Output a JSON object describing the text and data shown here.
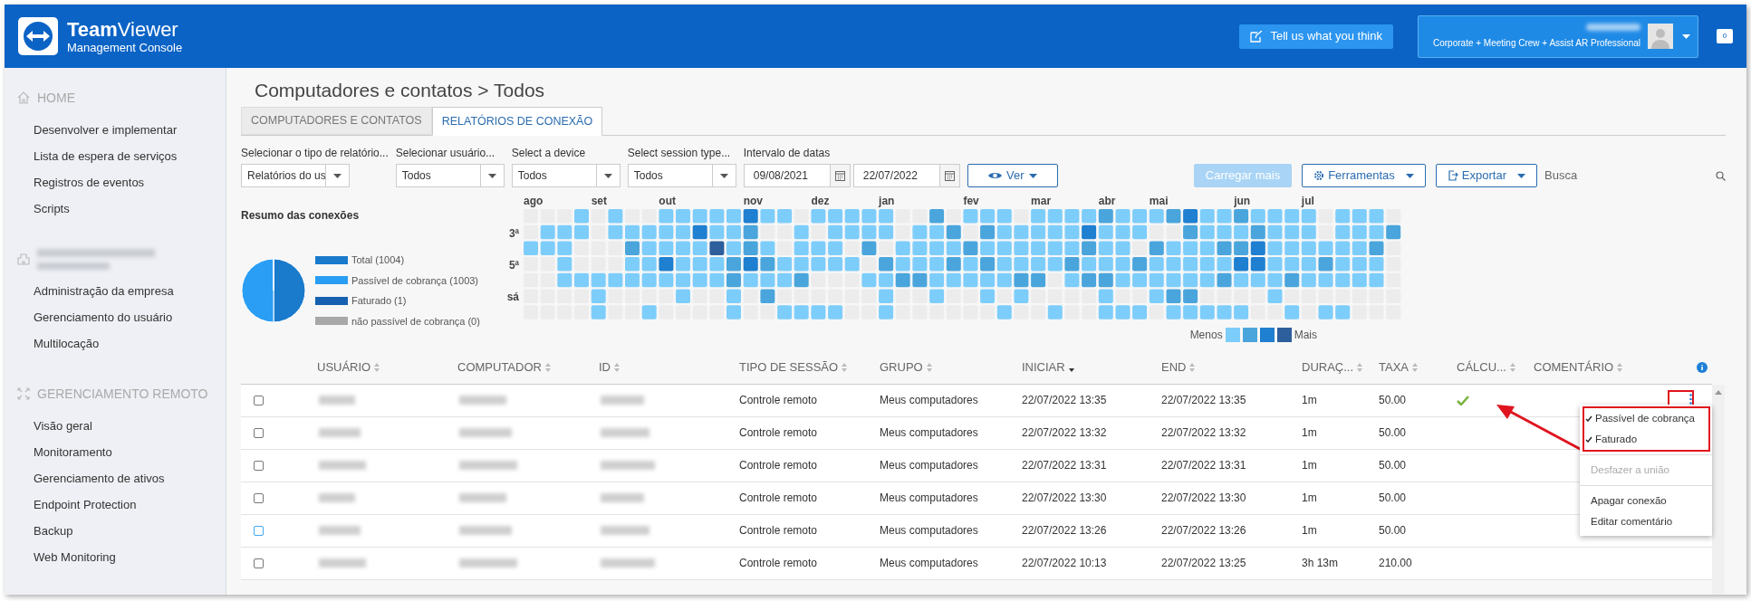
{
  "header": {
    "logo": "**Team**Viewer",
    "subtitle": "Management Console",
    "feedback_button": "Tell us what you think",
    "account": {
      "plan": "Corporate + Meeting Crew + Assist AR Professional"
    },
    "notifications": "0"
  },
  "sidebar": {
    "sections": [
      {
        "kind": "heading",
        "title": "HOME",
        "items": [
          "Desenvolver e implementar",
          "Lista de espera de serviços",
          "Registros de eventos",
          "Scripts"
        ]
      },
      {
        "kind": "redacted",
        "items": [
          "Administração da empresa",
          "Gerenciamento do usuário",
          "Multilocação"
        ]
      },
      {
        "kind": "heading",
        "title": "GERENCIAMENTO REMOTO",
        "items": [
          "Visão geral",
          "Monitoramento",
          "Gerenciamento de ativos",
          "Endpoint Protection",
          "Backup",
          "Web Monitoring"
        ]
      }
    ]
  },
  "breadcrumb": "Computadores e contatos > Todos",
  "tabs": [
    {
      "label": "COMPUTADORES E CONTATOS",
      "selected": false
    },
    {
      "label": "RELATÓRIOS DE CONEXÃO",
      "selected": true
    }
  ],
  "filters": [
    {
      "kind": "select",
      "label": "Selecionar o tipo de relatório...",
      "value": "Relatórios do us"
    },
    {
      "kind": "select",
      "label": "Selecionar usuário...",
      "value": "Todos"
    },
    {
      "kind": "select",
      "label": "Select a device",
      "value": "Todos"
    },
    {
      "kind": "select",
      "label": "Select session type...",
      "value": "Todos"
    },
    {
      "kind": "daterange",
      "label": "Intervalo de datas",
      "values": [
        "09/08/2021",
        "22/07/2022"
      ]
    }
  ],
  "view_button": "Ver",
  "toolbar": {
    "buttons": [
      {
        "label": "Carregar mais",
        "kind": "primary",
        "disabled": true
      },
      {
        "label": "Ferramentas",
        "kind": "tools",
        "disabled": false
      },
      {
        "label": "Exportar",
        "kind": "export",
        "disabled": false
      }
    ],
    "search": {
      "placeholder": "Busca"
    }
  },
  "summary": {
    "title": "Resumo das conexões",
    "chart_data": {
      "type": "pie",
      "categories": [
        "Total (1004)",
        "Passível de cobrança (1003)",
        "Faturado (1)",
        "não passível de cobrança (0)"
      ],
      "values": [
        1004,
        1003,
        1,
        0
      ]
    },
    "legend": [
      {
        "color": "#1a7acb"
      },
      {
        "color": "#2a9df4"
      },
      {
        "color": "#1560b0"
      },
      {
        "color": "#a8a8a8"
      }
    ]
  },
  "heatmap": {
    "months": [
      "ago",
      "set",
      "out",
      "nov",
      "dez",
      "jan",
      "fev",
      "mar",
      "abr",
      "mai",
      "jun",
      "jul"
    ],
    "weekdays": [
      "3ª",
      "5ª",
      "sá"
    ],
    "legend": {
      "low": "Menos",
      "high": "Mais"
    }
  },
  "table": {
    "columns": [
      {
        "label": "USUÁRIO",
        "kind": "redacted",
        "sorted": false
      },
      {
        "label": "COMPUTADOR",
        "kind": "redacted",
        "sorted": false
      },
      {
        "label": "ID",
        "kind": "redacted",
        "sorted": false
      },
      {
        "label": "TIPO DE SESSÃO",
        "kind": "text",
        "sorted": false
      },
      {
        "label": "GRUPO",
        "kind": "text",
        "sorted": false
      },
      {
        "label": "INICIAR",
        "kind": "text",
        "sorted": true
      },
      {
        "label": "END",
        "kind": "text",
        "sorted": false
      },
      {
        "label": "DURAÇ...",
        "kind": "text",
        "sorted": false
      },
      {
        "label": "TAXA",
        "kind": "text",
        "sorted": false
      },
      {
        "label": "CÁLCU...",
        "kind": "check",
        "sorted": false
      },
      {
        "label": "COMENTÁRIO",
        "kind": "text",
        "sorted": false
      }
    ],
    "rows": [
      {
        "checked": false,
        "hovered": false,
        "calculated": true,
        "cells": [
          "",
          "",
          "",
          "Controle remoto",
          "Meus computadores",
          "22/07/2022 13:35",
          "22/07/2022 13:35",
          "1m",
          "50.00",
          "",
          ""
        ]
      },
      {
        "checked": false,
        "hovered": false,
        "calculated": false,
        "cells": [
          "",
          "",
          "",
          "Controle remoto",
          "Meus computadores",
          "22/07/2022 13:32",
          "22/07/2022 13:32",
          "1m",
          "50.00",
          "",
          ""
        ]
      },
      {
        "checked": false,
        "hovered": false,
        "calculated": false,
        "cells": [
          "",
          "",
          "",
          "Controle remoto",
          "Meus computadores",
          "22/07/2022 13:31",
          "22/07/2022 13:31",
          "1m",
          "50.00",
          "",
          ""
        ]
      },
      {
        "checked": false,
        "hovered": false,
        "calculated": false,
        "cells": [
          "",
          "",
          "",
          "Controle remoto",
          "Meus computadores",
          "22/07/2022 13:30",
          "22/07/2022 13:30",
          "1m",
          "50.00",
          "",
          ""
        ]
      },
      {
        "checked": false,
        "hovered": true,
        "calculated": false,
        "cells": [
          "",
          "",
          "",
          "Controle remoto",
          "Meus computadores",
          "22/07/2022 13:26",
          "22/07/2022 13:26",
          "1m",
          "50.00",
          "",
          ""
        ]
      },
      {
        "checked": false,
        "hovered": false,
        "calculated": false,
        "cells": [
          "",
          "",
          "",
          "Controle remoto",
          "Meus computadores",
          "22/07/2022 10:13",
          "22/07/2022 13:25",
          "3h 13m",
          "210.00",
          "",
          ""
        ]
      }
    ]
  },
  "context_menu": {
    "groups": [
      [
        {
          "label": "Passível de cobrança",
          "checked": true,
          "disabled": false
        },
        {
          "label": "Faturado",
          "checked": true,
          "disabled": false
        }
      ],
      [
        {
          "label": "Desfazer a união",
          "checked": false,
          "disabled": true
        }
      ],
      [
        {
          "label": "Apagar conexão",
          "checked": false,
          "disabled": false
        },
        {
          "label": "Editar comentário",
          "checked": false,
          "disabled": false
        }
      ]
    ]
  }
}
